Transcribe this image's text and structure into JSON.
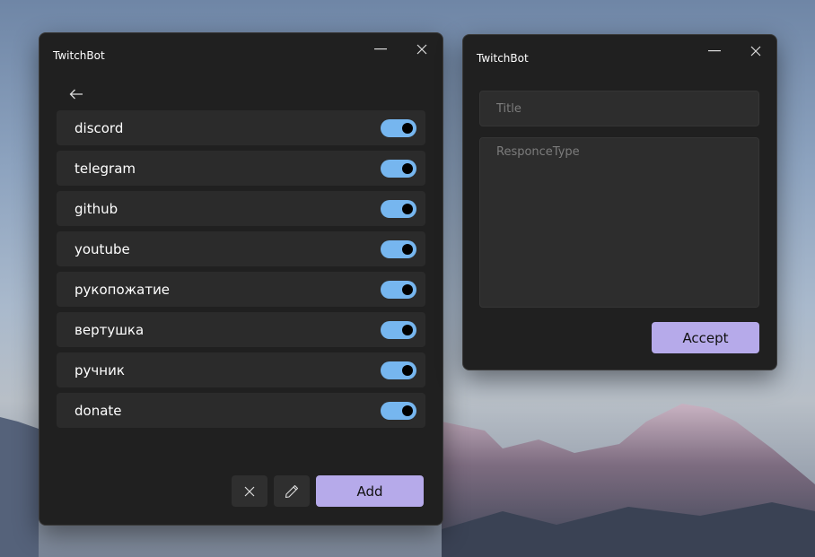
{
  "colors": {
    "accent": "#b6aaea",
    "toggle_on": "#76b6ef",
    "window_bg": "#202020",
    "row_bg": "#2b2b2b"
  },
  "main_window": {
    "title": "TwitchBot",
    "items": [
      {
        "label": "discord",
        "enabled": true
      },
      {
        "label": "telegram",
        "enabled": true
      },
      {
        "label": "github",
        "enabled": true
      },
      {
        "label": "youtube",
        "enabled": true
      },
      {
        "label": "рукопожатие",
        "enabled": true
      },
      {
        "label": "вертушка",
        "enabled": true
      },
      {
        "label": "ручник",
        "enabled": true
      },
      {
        "label": "donate",
        "enabled": true
      }
    ],
    "add_label": "Add",
    "icons": {
      "back": "arrow-left-icon",
      "delete": "close-icon",
      "edit": "pencil-icon"
    }
  },
  "edit_window": {
    "title": "TwitchBot",
    "title_placeholder": "Title",
    "responce_placeholder": "ResponceType",
    "accept_label": "Accept"
  }
}
